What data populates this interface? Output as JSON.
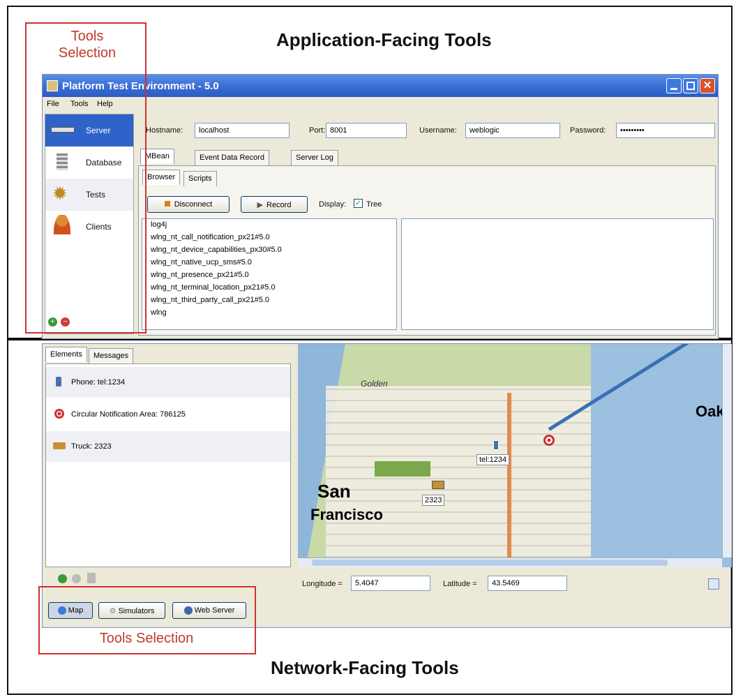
{
  "headings": {
    "top": "Application-Facing Tools",
    "bottom": "Network-Facing Tools",
    "tools_top": "Tools\nSelection",
    "tools_bottom": "Tools Selection"
  },
  "app_window": {
    "title": "Platform Test Environment - 5.0",
    "menu": [
      "File",
      "Tools",
      "Help"
    ],
    "sidebar": [
      {
        "label": "Server",
        "selected": true,
        "icon": "server-icon"
      },
      {
        "label": "Database",
        "icon": "database-icon"
      },
      {
        "label": "Tests",
        "icon": "tests-icon"
      },
      {
        "label": "Clients",
        "icon": "clients-icon"
      }
    ],
    "fields": {
      "hostname_label": "Hostname:",
      "hostname": "localhost",
      "port_label": "Port:",
      "port": "8001",
      "username_label": "Username:",
      "username": "weblogic",
      "password_label": "Password:",
      "password": "•••••••••"
    },
    "tabs": [
      "MBean",
      "Event Data Record",
      "Server Log"
    ],
    "subtabs": [
      "Browser",
      "Scripts"
    ],
    "disconnect_label": "Disconnect",
    "record_label": "Record",
    "display_label": "Display:",
    "tree_label": "Tree",
    "tree_items": [
      "log4j",
      "wlng_nt_call_notification_px21#5.0",
      "wlng_nt_device_capabilities_px30#5.0",
      "wlng_nt_native_ucp_sms#5.0",
      "wlng_nt_presence_px21#5.0",
      "wlng_nt_terminal_location_px21#5.0",
      "wlng_nt_third_party_call_px21#5.0",
      "wlng"
    ]
  },
  "net_window": {
    "tabs": [
      "Elements",
      "Messages"
    ],
    "elements": [
      {
        "label": "Phone: tel:1234",
        "icon": "phone-icon"
      },
      {
        "label": "Circular Notification Area: 786125",
        "icon": "target-icon"
      },
      {
        "label": "Truck: 2323",
        "icon": "truck-icon"
      }
    ],
    "longitude_label": "Longitude =",
    "longitude": "5.4047",
    "latitude_label": "Latitude =",
    "latitude": "43.5469",
    "bottom_tabs": [
      "Map",
      "Simulators",
      "Web Server"
    ],
    "map_labels": {
      "san": "San",
      "francisco": "Francisco",
      "tel": "tel:1234",
      "truck": "2323",
      "oak": "Oak",
      "golden": "Golden"
    }
  },
  "colors": {
    "accent": "#3a6fd6",
    "red": "#d03030"
  }
}
